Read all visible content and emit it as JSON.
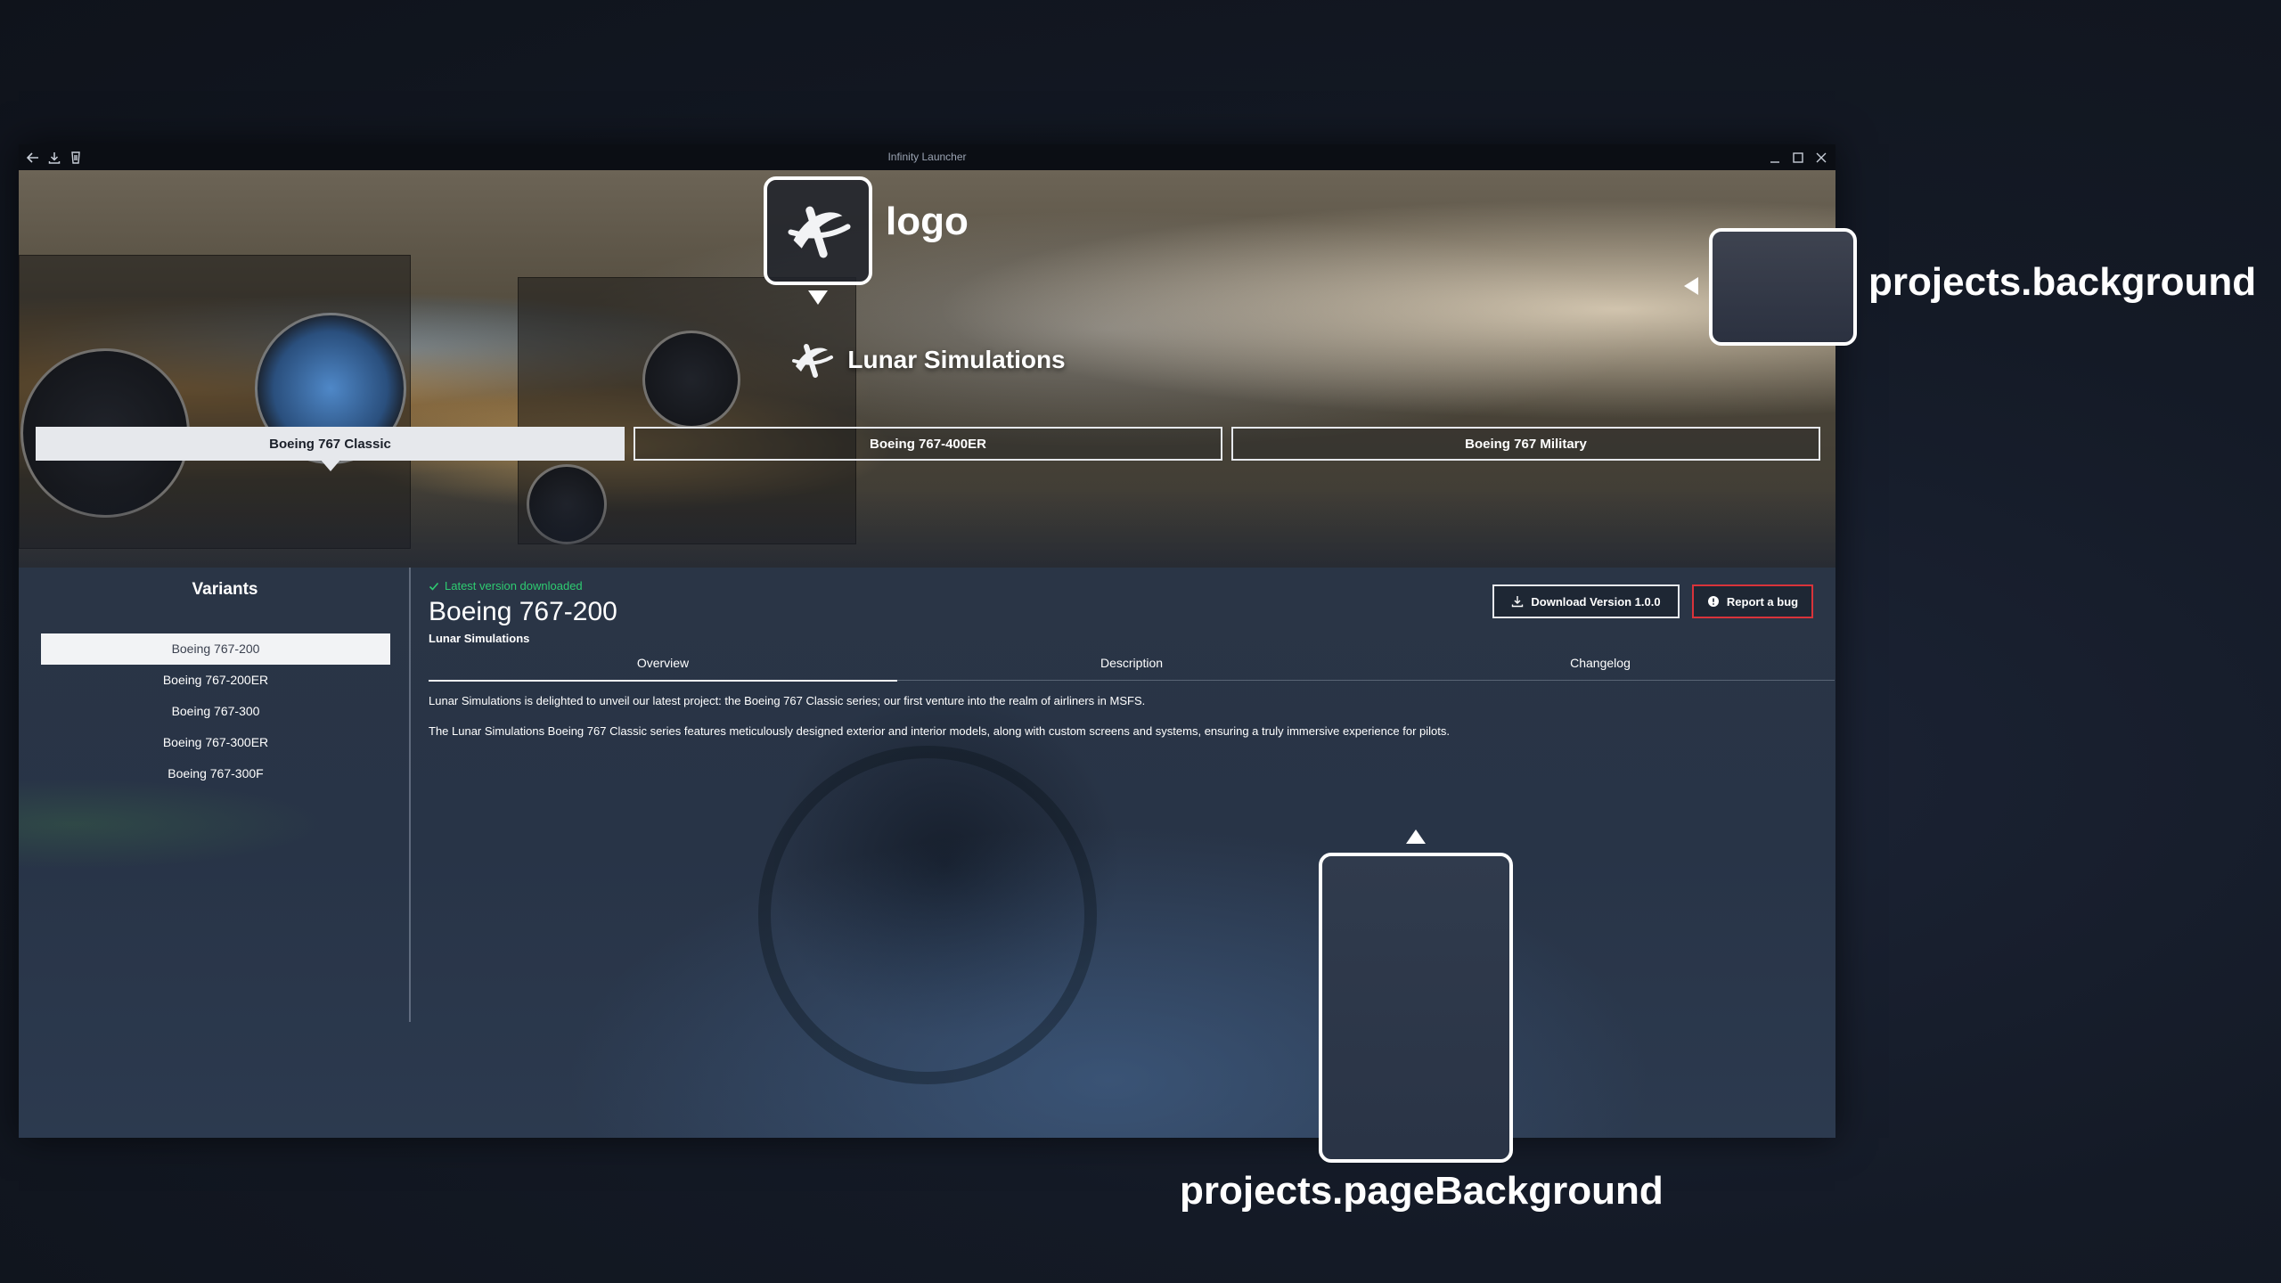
{
  "window": {
    "title": "Infinity Launcher"
  },
  "brand": {
    "name": "Lunar Simulations"
  },
  "series_tabs": [
    {
      "label": "Boeing 767 Classic",
      "active": true
    },
    {
      "label": "Boeing 767-400ER",
      "active": false
    },
    {
      "label": "Boeing 767 Military",
      "active": false
    }
  ],
  "sidebar": {
    "title": "Variants",
    "items": [
      {
        "label": "Boeing 767-200",
        "active": true
      },
      {
        "label": "Boeing 767-200ER",
        "active": false
      },
      {
        "label": "Boeing 767-300",
        "active": false
      },
      {
        "label": "Boeing 767-300ER",
        "active": false
      },
      {
        "label": "Boeing 767-300F",
        "active": false
      }
    ]
  },
  "project": {
    "status": "Latest version downloaded",
    "title": "Boeing 767-200",
    "developer": "Lunar Simulations",
    "download_label": "Download Version 1.0.0",
    "report_label": "Report a bug",
    "tabs": [
      {
        "label": "Overview",
        "active": true
      },
      {
        "label": "Description",
        "active": false
      },
      {
        "label": "Changelog",
        "active": false
      }
    ],
    "overview": [
      "Lunar Simulations is delighted to unveil our latest project: the Boeing 767 Classic series; our first venture into the realm of airliners in MSFS.",
      "The Lunar Simulations Boeing 767 Classic series features meticulously designed exterior and interior models, along with custom screens and systems, ensuring a truly immersive experience for pilots."
    ]
  },
  "annotations": {
    "logo": "logo",
    "background": "projects.background",
    "page_background": "projects.pageBackground"
  },
  "colors": {
    "status_green": "#2ecc71",
    "report_red": "#d9333a",
    "active_tab_bg": "#e6e8ec"
  }
}
